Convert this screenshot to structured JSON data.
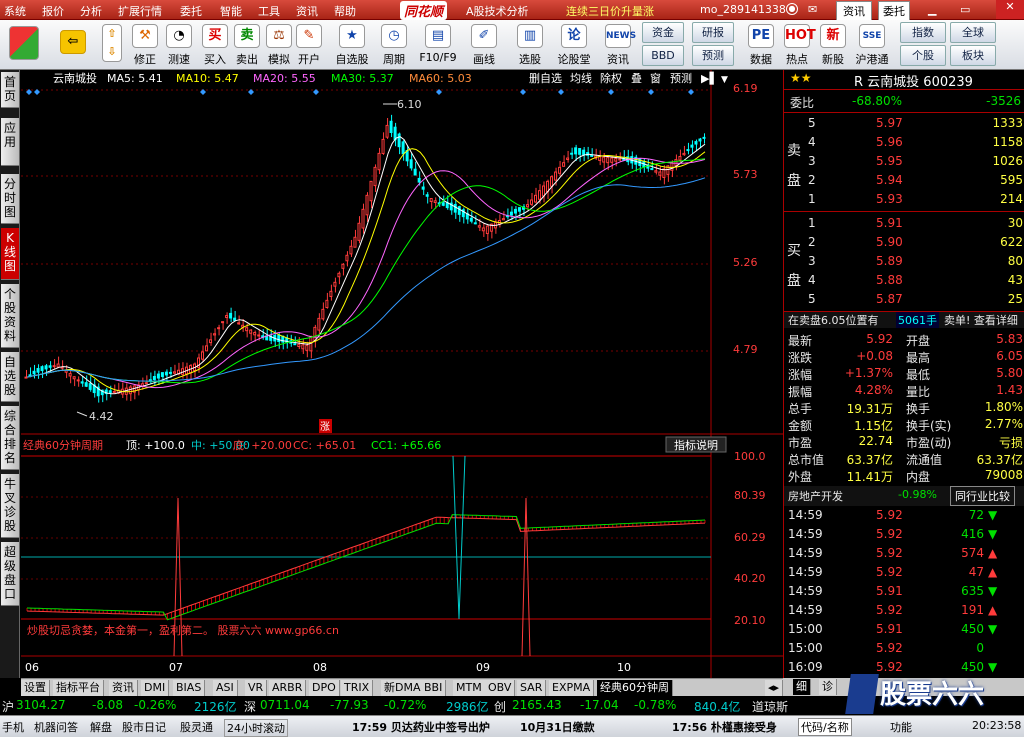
{
  "menu": {
    "items": [
      "系统",
      "报价",
      "分析",
      "扩展行情",
      "委托",
      "智能",
      "工具",
      "资讯",
      "帮助"
    ],
    "brand": "同花顺",
    "app_title": "A股技术分析",
    "promo": "连续三日价升量涨",
    "account": "mo_289141338",
    "news_btn": "资讯",
    "trade_btn": "委托"
  },
  "toolbar": {
    "buttons": [
      "修正",
      "测速",
      "买入",
      "卖出",
      "模拟",
      "开户",
      "自选股",
      "周期",
      "F10/F9",
      "画线",
      "选股",
      "论股堂",
      "资讯",
      "数据",
      "热点",
      "新股",
      "沪港通"
    ],
    "small": [
      "资金",
      "BBD",
      "研报",
      "预测",
      "指数",
      "全球",
      "个股",
      "板块"
    ]
  },
  "left_tabs": [
    "首页",
    "应用",
    "分时图",
    "K线图",
    "个股资料",
    "自选股",
    "综合排名",
    "牛叉诊股",
    "超级盘口"
  ],
  "kline": {
    "stock": "云南城投",
    "ma5": "MA5: 5.41",
    "ma10": "MA10: 5.47",
    "ma20": "MA20: 5.55",
    "ma30": "MA30: 5.37",
    "ma60": "MA60: 5.03",
    "btns": [
      "删自选",
      "均线",
      "除权",
      "叠",
      "窗",
      "预测"
    ],
    "y_ticks": [
      "6.19",
      "5.73",
      "5.26",
      "4.79"
    ],
    "max_label": "6.10",
    "min_label": "4.42",
    "zhang": "涨"
  },
  "indicator": {
    "title": "经典60分钟周期",
    "top": "顶: +100.0",
    "mid": "中: +50.00",
    "bot": "底: +20.00",
    "cc": "CC: +65.01",
    "cc1": "CC1: +65.66",
    "help": "指标说明",
    "y_ticks": [
      "100.0",
      "80.39",
      "60.29",
      "40.20",
      "20.10"
    ],
    "ad": "炒股切忌贪婪，本金第一，盈利第二。 股票六六 www.gp66.cn"
  },
  "x_axis": [
    "06",
    "07",
    "08",
    "09",
    "10"
  ],
  "quote": {
    "code_line": "R 云南城投 600239",
    "weibi_label": "委比",
    "weibi": "-68.80%",
    "weicha": "-3526",
    "sell": [
      {
        "n": "5",
        "p": "5.97",
        "v": "1333"
      },
      {
        "n": "4",
        "p": "5.96",
        "v": "1158"
      },
      {
        "n": "3",
        "p": "5.95",
        "v": "1026"
      },
      {
        "n": "2",
        "p": "5.94",
        "v": "595"
      },
      {
        "n": "1",
        "p": "5.93",
        "v": "214"
      }
    ],
    "buy": [
      {
        "n": "1",
        "p": "5.91",
        "v": "30"
      },
      {
        "n": "2",
        "p": "5.90",
        "v": "622"
      },
      {
        "n": "3",
        "p": "5.89",
        "v": "80"
      },
      {
        "n": "4",
        "p": "5.88",
        "v": "43"
      },
      {
        "n": "5",
        "p": "5.87",
        "v": "25"
      }
    ],
    "sell_label": "卖盘",
    "buy_label": "买盘",
    "notice": "在卖盘6.05位置有",
    "notice_vol": "5061手",
    "notice_end": "卖单! 查看详细",
    "stats": [
      [
        "最新",
        "5.92",
        "开盘",
        "5.83"
      ],
      [
        "涨跌",
        "+0.08",
        "最高",
        "6.05"
      ],
      [
        "涨幅",
        "+1.37%",
        "最低",
        "5.80"
      ],
      [
        "振幅",
        "4.28%",
        "量比",
        "1.43"
      ],
      [
        "总手",
        "19.31万",
        "换手",
        "1.80%"
      ],
      [
        "金额",
        "1.15亿",
        "换手(实)",
        "2.77%"
      ],
      [
        "市盈",
        "22.74",
        "市盈(动)",
        "亏损"
      ],
      [
        "总市值",
        "63.37亿",
        "流通值",
        "63.37亿"
      ],
      [
        "外盘",
        "11.41万",
        "内盘",
        "79008"
      ]
    ],
    "industry": "房地产开发",
    "industry_chg": "-0.98%",
    "compare": "同行业比较",
    "ticks": [
      [
        "14:59",
        "5.92",
        "72",
        "d"
      ],
      [
        "14:59",
        "5.92",
        "416",
        "d"
      ],
      [
        "14:59",
        "5.92",
        "574",
        "u"
      ],
      [
        "14:59",
        "5.92",
        "47",
        "u"
      ],
      [
        "14:59",
        "5.91",
        "635",
        "d"
      ],
      [
        "14:59",
        "5.92",
        "191",
        "u"
      ],
      [
        "15:00",
        "5.91",
        "450",
        "d"
      ],
      [
        "15:00",
        "5.92",
        "0",
        ""
      ],
      [
        "16:09",
        "5.92",
        "450",
        "d"
      ]
    ]
  },
  "bottom_tabs": [
    "设置",
    "指标平台",
    "资讯",
    "DMI",
    "BIAS",
    "ASI",
    "VR",
    "ARBR",
    "DPO",
    "TRIX",
    "新DMA",
    "BBI",
    "MTM",
    "OBV",
    "SAR",
    "EXPMA",
    "经典60分钟周"
  ],
  "right_tabs": [
    "细",
    "诊"
  ],
  "index_bar": [
    "沪",
    "3104.27",
    "-8.08",
    "-0.26%",
    "2126亿",
    "深",
    "0711.04",
    "-77.93",
    "-0.72%",
    "2986亿",
    "创",
    "2165.43",
    "-17.04",
    "-0.78%",
    "840.4亿",
    "道琼斯"
  ],
  "status": {
    "items": [
      "手机",
      "机器问答",
      "解盘",
      "股市日记",
      "股灵通",
      "24小时滚动"
    ],
    "news1": "17:59 贝达药业中签号出炉",
    "news2": "10月31日缴款",
    "news3": "17:56 朴槿惠接受身",
    "code_lbl": "代码/名称",
    "func": "功能",
    "time": "20:23:58"
  },
  "watermark": "股票六六",
  "colors": {
    "up": "#ff3b3b",
    "down": "#00ffff",
    "ma5": "#ffffff",
    "ma10": "#ffff00",
    "ma20": "#ff66ff",
    "ma30": "#00ff00",
    "ma60": "#3399ff"
  }
}
